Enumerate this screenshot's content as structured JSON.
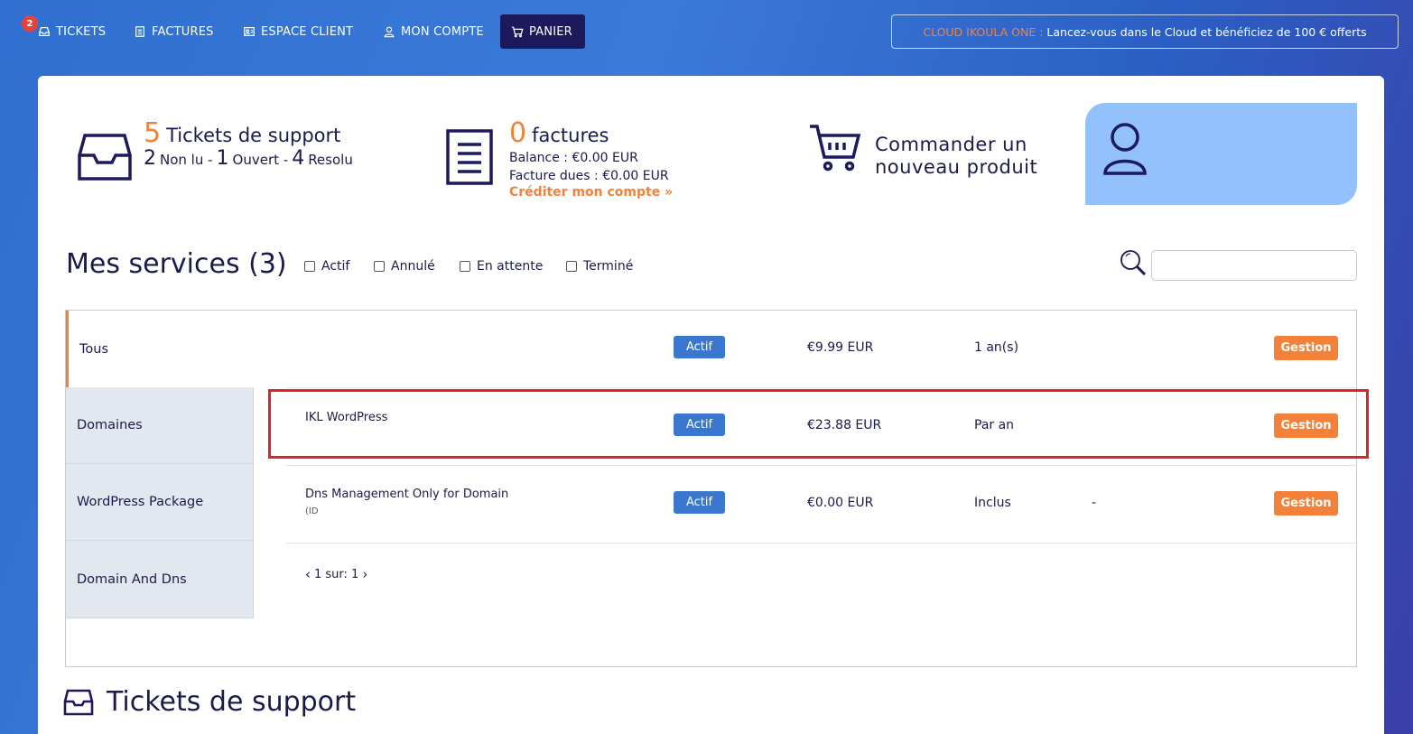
{
  "nav": {
    "ticket_badge": "2",
    "items": [
      {
        "label": "TICKETS",
        "icon": "inbox-icon"
      },
      {
        "label": "FACTURES",
        "icon": "invoice-icon"
      },
      {
        "label": "ESPACE CLIENT",
        "icon": "client-space-icon"
      },
      {
        "label": "MON COMPTE",
        "icon": "user-icon"
      },
      {
        "label": "PANIER",
        "icon": "cart-icon"
      }
    ],
    "promo_accent": "CLOUD IKOULA ONE :",
    "promo_text": "Lancez-vous dans le Cloud et bénéficiez de 100 € offerts"
  },
  "stats": {
    "tickets": {
      "count": "5",
      "title": "Tickets de support",
      "unread": "2",
      "unread_label": "Non lu -",
      "open": "1",
      "open_label": "Ouvert -",
      "resolved": "4",
      "resolved_label": "Resolu"
    },
    "invoices": {
      "count": "0",
      "title": "factures",
      "balance": "Balance : €0.00 EUR",
      "due": "Facture dues : €0.00 EUR",
      "credit_link": "Créditer mon compte »"
    },
    "order": {
      "line1": "Commander un",
      "line2": "nouveau produit"
    }
  },
  "services": {
    "title": "Mes services (3)",
    "filters": [
      "Actif",
      "Annulé",
      "En attente",
      "Terminé"
    ],
    "search_placeholder": "",
    "side_tabs": [
      "Tous",
      "Domaines",
      "WordPress Package",
      "Domain And Dns"
    ],
    "rows": [
      {
        "name": "",
        "id": "",
        "status": "Actif",
        "price": "€9.99 EUR",
        "cycle": "1 an(s)",
        "due": "",
        "action": "Gestion"
      },
      {
        "name": "IKL WordPress",
        "id": "",
        "status": "Actif",
        "price": "€23.88 EUR",
        "cycle": "Par an",
        "due": "",
        "action": "Gestion"
      },
      {
        "name": "Dns Management Only for Domain",
        "id": "(ID",
        "status": "Actif",
        "price": "€0.00 EUR",
        "cycle": "Inclus",
        "due": "-",
        "action": "Gestion"
      }
    ],
    "pager": "1 sur: 1"
  },
  "tickets_section": {
    "title": "Tickets de support"
  },
  "colors": {
    "accent": "#f4813a",
    "navy": "#1c1a5c",
    "status_blue": "#3b76cf",
    "highlight_red": "#e0222a"
  }
}
